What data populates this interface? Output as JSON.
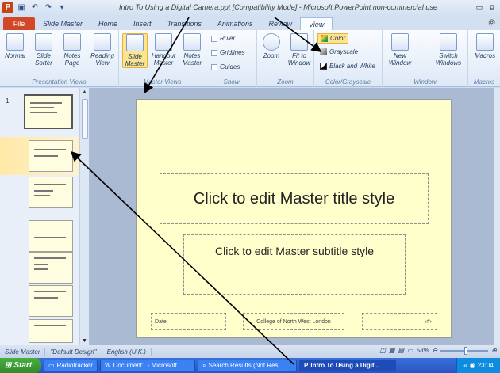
{
  "window": {
    "title": "Intro To Using a Digital Camera.ppt [Compatibility Mode] - Microsoft PowerPoint non-commercial use",
    "app_icon": "P"
  },
  "tabs": [
    {
      "label": "File"
    },
    {
      "label": "Slide Master"
    },
    {
      "label": "Home"
    },
    {
      "label": "Insert"
    },
    {
      "label": "Transitions"
    },
    {
      "label": "Animations"
    },
    {
      "label": "Review"
    },
    {
      "label": "View"
    }
  ],
  "ribbon": {
    "presentation_views": {
      "group_label": "Presentation Views",
      "buttons": [
        "Normal",
        "Slide Sorter",
        "Notes Page",
        "Reading View"
      ]
    },
    "master_views": {
      "group_label": "Master Views",
      "buttons": [
        "Slide Master",
        "Handout Master",
        "Notes Master"
      ]
    },
    "show": {
      "group_label": "Show",
      "checkboxes": [
        "Ruler",
        "Gridlines",
        "Guides"
      ]
    },
    "zoom": {
      "group_label": "Zoom",
      "buttons": [
        "Zoom",
        "Fit to Window"
      ]
    },
    "color_grayscale": {
      "group_label": "Color/Grayscale",
      "options": [
        "Color",
        "Grayscale",
        "Black and White"
      ]
    },
    "window": {
      "group_label": "Window",
      "buttons": [
        "New Window",
        "Switch Windows"
      ]
    },
    "macros": {
      "group_label": "Macros",
      "buttons": [
        "Macros"
      ]
    }
  },
  "slides_pane": {
    "first_number": "1"
  },
  "slide": {
    "title": "Click to edit Master title style",
    "subtitle": "Click to edit Master subtitle style",
    "date": "Date",
    "footer": "College of North West London",
    "number": "‹#›"
  },
  "statusbar": {
    "view": "Slide Master",
    "theme": "\"Default Design\"",
    "language": "English (U.K.)",
    "zoom": "53%",
    "zoom_fraction": 0.53
  },
  "taskbar": {
    "start": "Start",
    "tasks": [
      "Radiotracker",
      "Document1 - Microsoft ...",
      "Search Results (Not Res...",
      "Intro To Using a Digit..."
    ],
    "tray_chevron": "«",
    "clock": "23:04"
  },
  "colors": {
    "file_tab": "#d24726",
    "slide_bg": "#ffffcc",
    "selected_button": "#fde48f",
    "taskbar": "#2656c3"
  }
}
